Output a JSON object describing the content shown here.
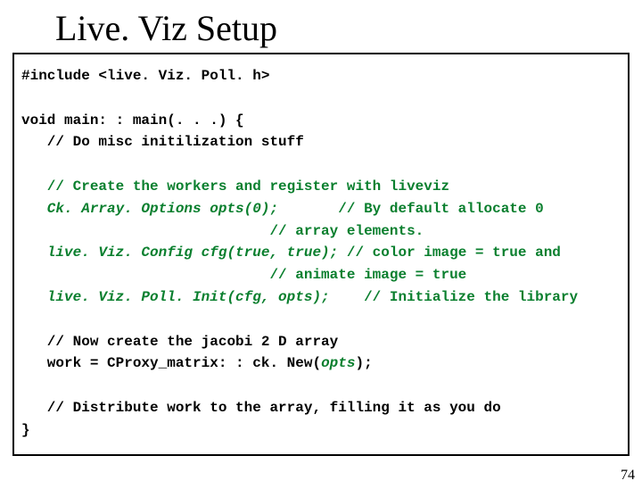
{
  "title": "Live. Viz Setup",
  "slide_number": "74",
  "code": {
    "l1": "#include <live. Viz. Poll. h>",
    "l2": "void main: : main(. . .) {",
    "l3": "   // Do misc initilization stuff",
    "l4": "   // Create the workers and register with liveviz",
    "l5a": "   Ck. Array. Options opts(0);",
    "l5b": "       // By default allocate 0",
    "l6": "                             // array elements.",
    "l7a": "   live. Viz. Config cfg(true, true);",
    "l7b": " // color image = true and",
    "l8": "                             // animate image = true",
    "l9a": "   live. Viz. Poll. Init(cfg, opts);",
    "l9b": "    // Initialize the library",
    "l10": "   // Now create the jacobi 2 D array",
    "l11a": "   work = CProxy_matrix: : ck. New(",
    "l11b": "opts",
    "l11c": ");",
    "l12": "   // Distribute work to the array, filling it as you do",
    "l13": "}"
  }
}
